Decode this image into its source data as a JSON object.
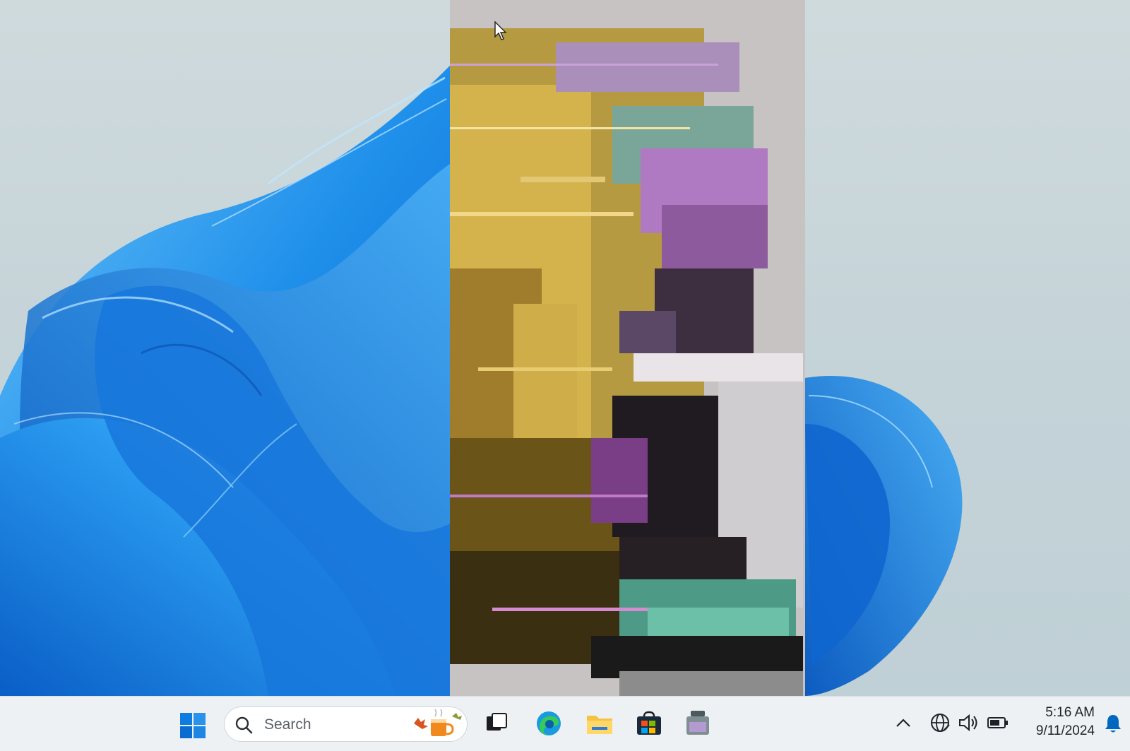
{
  "desktop": {
    "wallpaper": "bloom",
    "colors": {
      "bloom": "#1e8fea",
      "bloom_light": "#55b8f6",
      "bloom_dark": "#0a5fc4",
      "background": "#c9d6da"
    },
    "glitch_region": "corrupted display strip"
  },
  "taskbar": {
    "start_icon": "windows-logo-icon",
    "search": {
      "label": "Search",
      "icon": "search-icon",
      "highlight_icon": "autumn-mug-icon"
    },
    "apps": [
      {
        "name": "task-view",
        "icon": "task-view-icon"
      },
      {
        "name": "edge",
        "icon": "edge-icon"
      },
      {
        "name": "file-explorer",
        "icon": "folder-icon"
      },
      {
        "name": "microsoft-store",
        "icon": "store-icon"
      },
      {
        "name": "app",
        "icon": "app-icon"
      }
    ],
    "tray": {
      "chevron_icon": "chevron-up-icon",
      "network_icon": "globe-icon",
      "volume_icon": "speaker-icon",
      "battery_icon": "battery-icon",
      "time": "5:16 AM",
      "date": "9/11/2024",
      "notification_icon": "bell-icon"
    },
    "accent": "#0067c0"
  }
}
